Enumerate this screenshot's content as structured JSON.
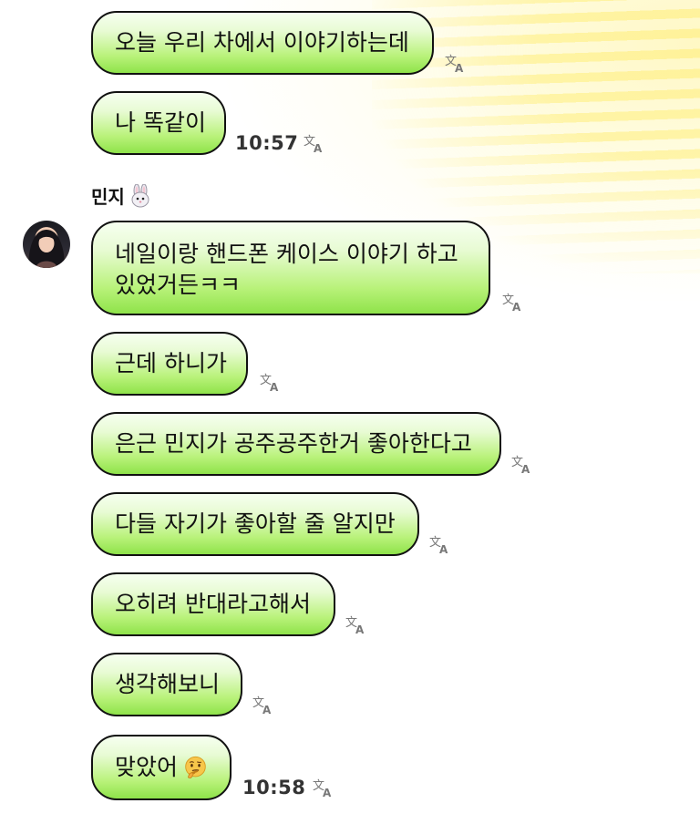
{
  "sender": {
    "name": "민지",
    "emoji_icon": "bunny-emoji-icon"
  },
  "messages": [
    {
      "text": "오늘 우리 차에서 이야기하는데"
    },
    {
      "text": "나 똑같이",
      "time": "10:57"
    },
    {
      "text": "네일이랑 핸드폰 케이스 이야기 하고 있었거든ㅋㅋ"
    },
    {
      "text": "근데 하니가"
    },
    {
      "text": "은근 민지가 공주공주한거 좋아한다고"
    },
    {
      "text": "다들 자기가 좋아할 줄 알지만"
    },
    {
      "text": "오히려 반대라고해서"
    },
    {
      "text": "생각해보니"
    },
    {
      "text": "맞았어",
      "time": "10:58",
      "emoji_icon": "thinking-face-emoji-icon"
    }
  ],
  "colors": {
    "bubble_top": "#f6fff0",
    "bubble_bottom": "#8fe34a",
    "bubble_border": "#111111",
    "background_accent": "#fff07a"
  }
}
